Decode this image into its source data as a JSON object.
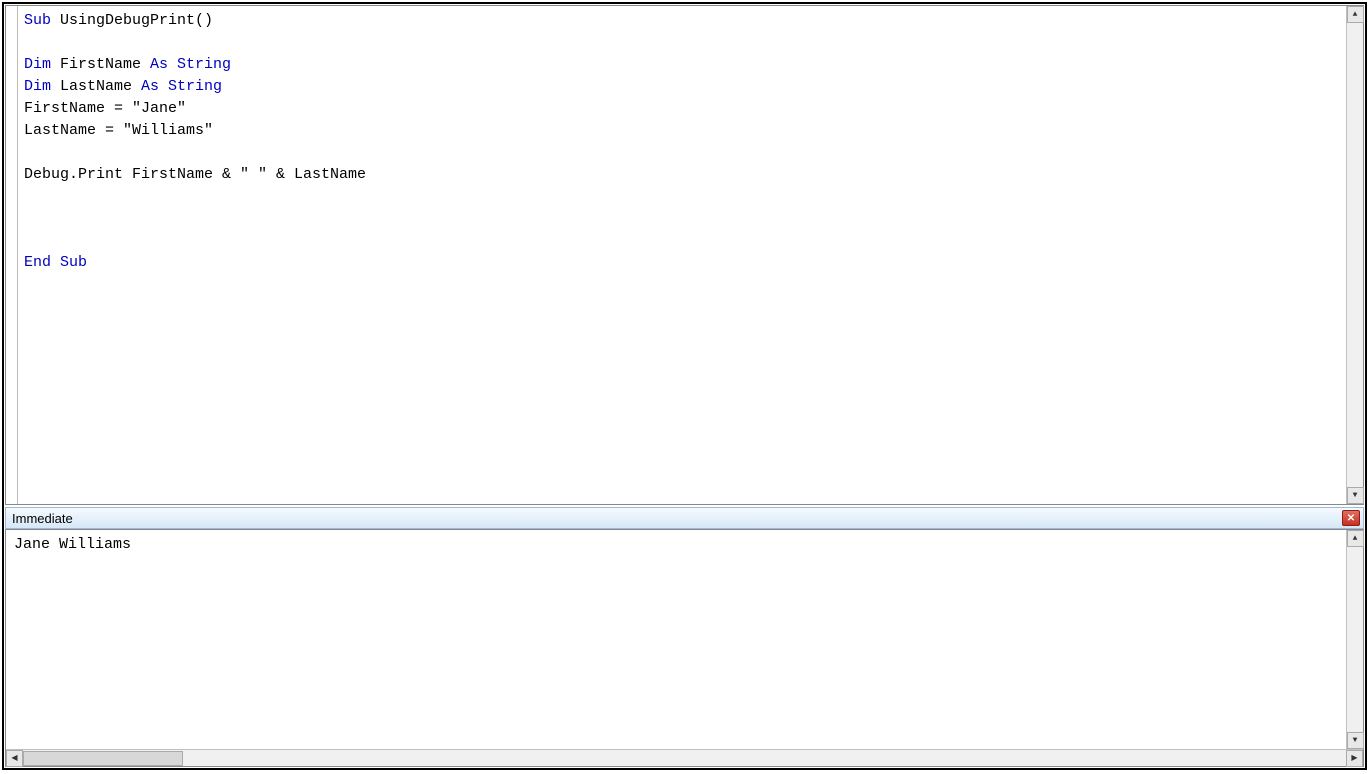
{
  "code": {
    "lines": [
      {
        "tokens": [
          {
            "t": "Sub ",
            "c": "kw"
          },
          {
            "t": "UsingDebugPrint()",
            "c": "txt"
          }
        ]
      },
      {
        "tokens": [
          {
            "t": "",
            "c": "txt"
          }
        ]
      },
      {
        "tokens": [
          {
            "t": "Dim ",
            "c": "kw"
          },
          {
            "t": "FirstName ",
            "c": "txt"
          },
          {
            "t": "As String",
            "c": "kw"
          }
        ]
      },
      {
        "tokens": [
          {
            "t": "Dim ",
            "c": "kw"
          },
          {
            "t": "LastName ",
            "c": "txt"
          },
          {
            "t": "As String",
            "c": "kw"
          }
        ]
      },
      {
        "tokens": [
          {
            "t": "FirstName = \"Jane\"",
            "c": "txt"
          }
        ]
      },
      {
        "tokens": [
          {
            "t": "LastName = \"Williams\"",
            "c": "txt"
          }
        ]
      },
      {
        "tokens": [
          {
            "t": "",
            "c": "txt"
          }
        ]
      },
      {
        "tokens": [
          {
            "t": "Debug.Print FirstName & \" \" & LastName",
            "c": "txt"
          }
        ]
      },
      {
        "tokens": [
          {
            "t": "",
            "c": "txt"
          }
        ]
      },
      {
        "tokens": [
          {
            "t": "",
            "c": "txt"
          }
        ]
      },
      {
        "tokens": [
          {
            "t": "",
            "c": "txt"
          }
        ]
      },
      {
        "tokens": [
          {
            "t": "End Sub",
            "c": "kw"
          }
        ]
      }
    ]
  },
  "immediate": {
    "title": "Immediate",
    "output": "Jane Williams"
  }
}
